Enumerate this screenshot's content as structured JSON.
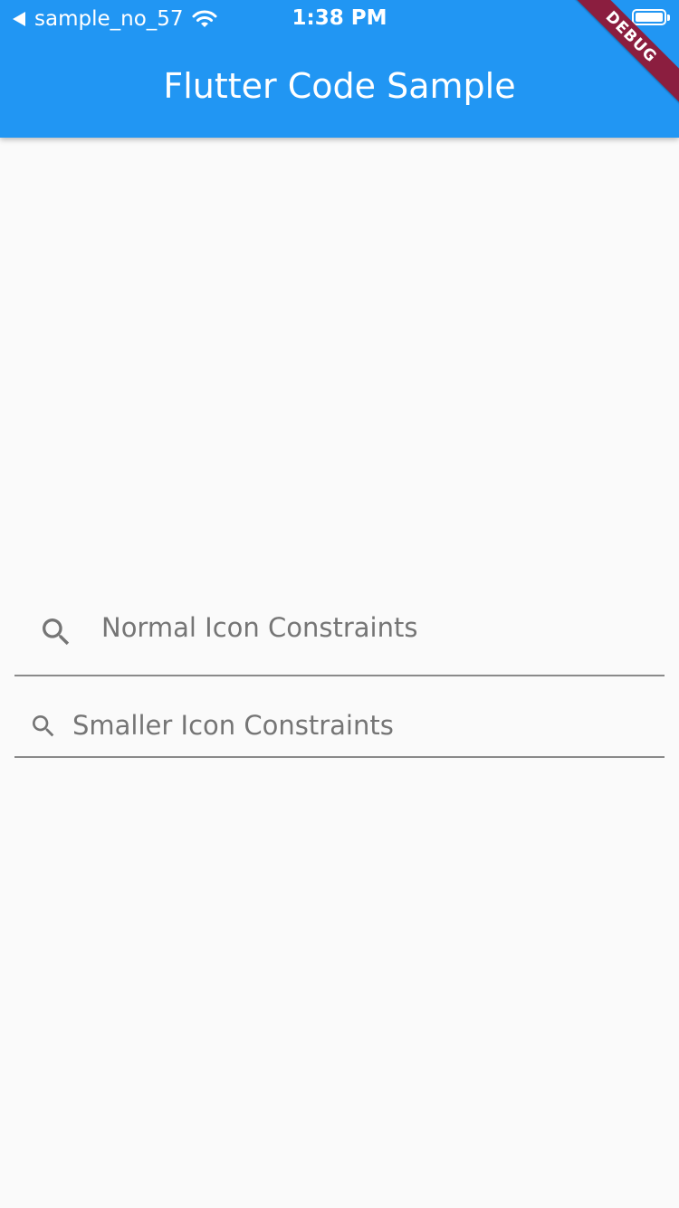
{
  "status_bar": {
    "back_app": "sample_no_57",
    "time": "1:38 PM",
    "back_icon": "back-arrow-icon",
    "wifi_icon": "wifi-icon",
    "battery_icon": "battery-icon"
  },
  "app_bar": {
    "title": "Flutter Code Sample"
  },
  "debug_banner": {
    "label": "DEBUG"
  },
  "fields": {
    "normal": {
      "placeholder": "Normal Icon Constraints",
      "icon": "search-icon"
    },
    "smaller": {
      "placeholder": "Smaller Icon Constraints",
      "icon": "search-icon"
    }
  },
  "colors": {
    "primary": "#2196f3",
    "background": "#fafafa",
    "hint": "#757575",
    "underline": "#8a8a8a",
    "debug_banner": "#8b1e3f"
  }
}
